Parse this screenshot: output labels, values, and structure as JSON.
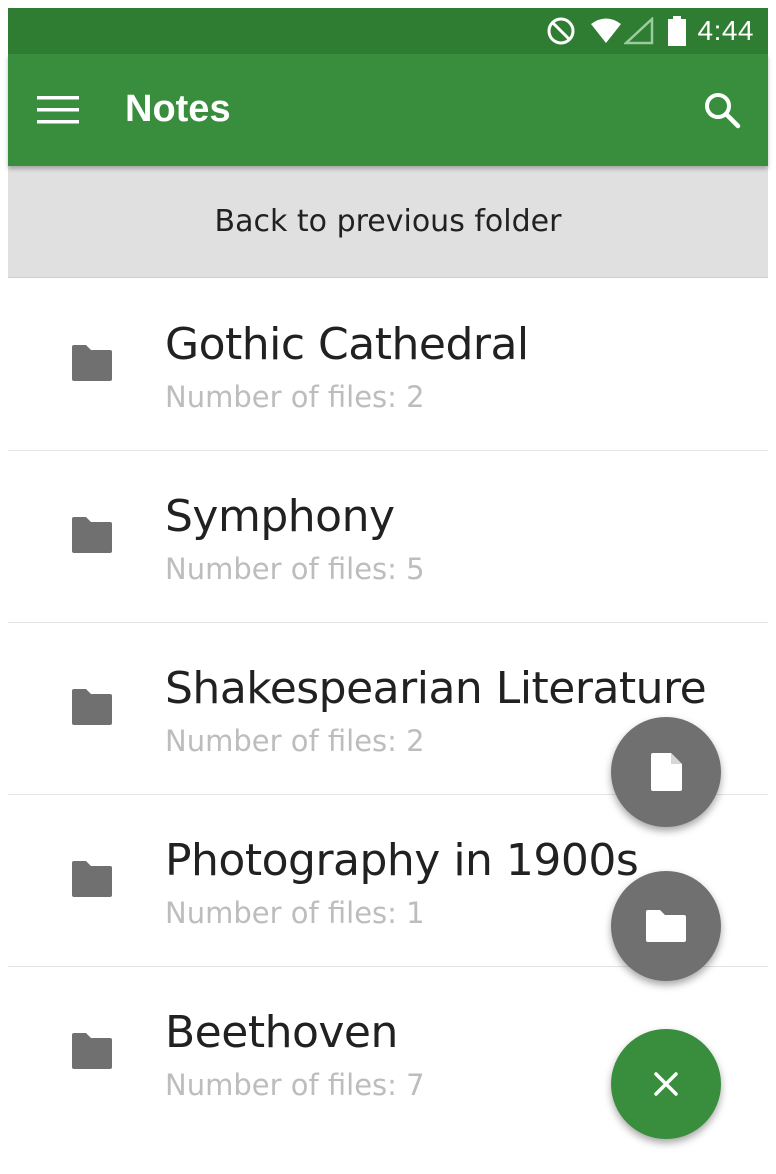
{
  "status_bar": {
    "time": "4:44",
    "icons": [
      "do-not-disturb-icon",
      "wifi-icon",
      "signal-icon",
      "battery-icon"
    ]
  },
  "app_bar": {
    "title": "Notes",
    "menu_icon": "menu-icon",
    "search_icon": "search-icon",
    "color": "#388e3c"
  },
  "back_button": {
    "label": "Back to previous folder"
  },
  "folders": [
    {
      "name": "Gothic Cathedral",
      "count": "Number of files: 2"
    },
    {
      "name": "Symphony",
      "count": "Number of files: 5"
    },
    {
      "name": "Shakespearian Literature",
      "count": "Number of files: 2"
    },
    {
      "name": "Photography in 1900s",
      "count": "Number of files: 1"
    },
    {
      "name": "Beethoven",
      "count": "Number of files: 7"
    }
  ],
  "fabs": {
    "new_note_icon": "note-icon",
    "new_folder_icon": "folder-icon",
    "close_icon": "close-icon",
    "mini_color": "#707070",
    "main_color": "#388e3c"
  }
}
